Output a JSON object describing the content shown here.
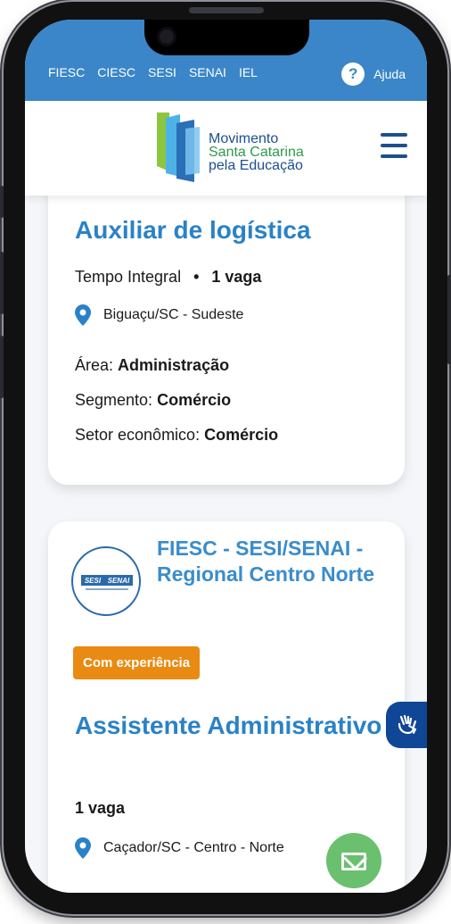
{
  "topbar": {
    "links": [
      "FIESC",
      "CIESC",
      "SESI",
      "SENAI",
      "IEL"
    ],
    "help_label": "Ajuda",
    "help_icon": "?"
  },
  "header": {
    "logo_lines": [
      "Movimento",
      "Santa Catarina",
      "pela Educação"
    ]
  },
  "jobs": [
    {
      "title": "Auxiliar de logística",
      "schedule": "Tempo Integral",
      "vacancies": "1 vaga",
      "location": "Biguaçu/SC - Sudeste",
      "area_label": "Área:",
      "area": "Administração",
      "segment_label": "Segmento:",
      "segment": "Comércio",
      "sector_label": "Setor econômico:",
      "sector": "Comércio"
    },
    {
      "org_logo_text": [
        "SESI",
        "SENAI"
      ],
      "org_name": "FIESC - SESI/SENAI - Regional Centro Norte",
      "badge": "Com experiência",
      "title": "Assistente Administrativo",
      "vacancies": "1 vaga",
      "location": "Caçador/SC - Centro - Norte"
    }
  ],
  "colors": {
    "primary": "#3a86c8",
    "title": "#2a82c6",
    "badge": "#e98b12",
    "libras": "#0f4696",
    "mail": "#6ac06e"
  }
}
